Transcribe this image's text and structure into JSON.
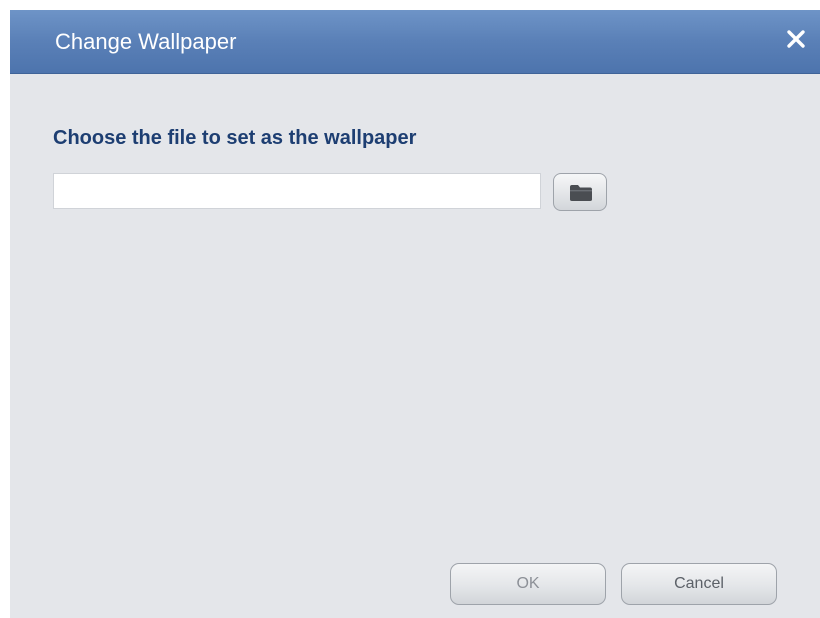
{
  "dialog": {
    "title": "Change Wallpaper",
    "prompt": "Choose the file to set as the wallpaper",
    "file_input": {
      "value": "",
      "placeholder": ""
    },
    "buttons": {
      "ok_label": "OK",
      "cancel_label": "Cancel"
    }
  },
  "icons": {
    "close": "close-icon",
    "browse": "folder-icon"
  },
  "colors": {
    "titlebar": "#5a80b7",
    "prompt_text": "#1d3e72",
    "dialog_background": "#e4e6ea"
  }
}
